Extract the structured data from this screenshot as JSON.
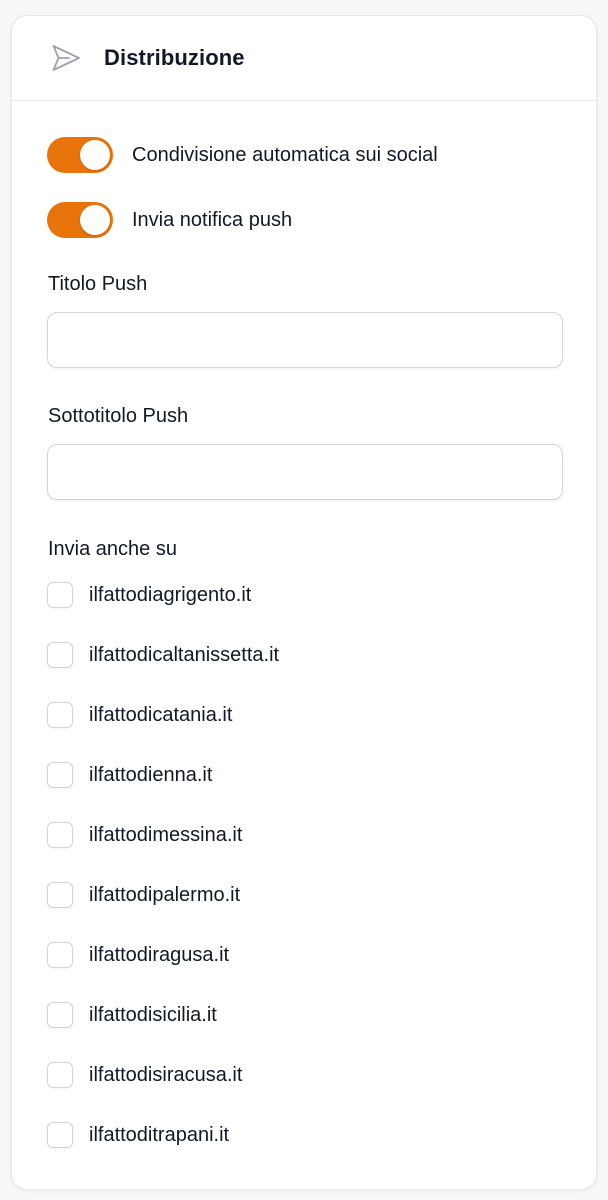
{
  "panel": {
    "title": "Distribuzione",
    "icon": "send-icon"
  },
  "toggles": [
    {
      "label": "Condivisione automatica sui social",
      "checked": true
    },
    {
      "label": "Invia notifica push",
      "checked": true
    }
  ],
  "push_title": {
    "label": "Titolo Push",
    "value": ""
  },
  "push_subtitle": {
    "label": "Sottotitolo Push",
    "value": ""
  },
  "also_send": {
    "label": "Invia anche su",
    "sites": [
      {
        "label": "ilfattodiagrigento.it",
        "checked": false
      },
      {
        "label": "ilfattodicaltanissetta.it",
        "checked": false
      },
      {
        "label": "ilfattodicatania.it",
        "checked": false
      },
      {
        "label": "ilfattodienna.it",
        "checked": false
      },
      {
        "label": "ilfattodimessina.it",
        "checked": false
      },
      {
        "label": "ilfattodipalermo.it",
        "checked": false
      },
      {
        "label": "ilfattodiragusa.it",
        "checked": false
      },
      {
        "label": "ilfattodisicilia.it",
        "checked": false
      },
      {
        "label": "ilfattodisiracusa.it",
        "checked": false
      },
      {
        "label": "ilfattoditrapani.it",
        "checked": false
      }
    ]
  },
  "colors": {
    "accent": "#e8730a",
    "border": "#e5e7eb",
    "text": "#111827"
  }
}
